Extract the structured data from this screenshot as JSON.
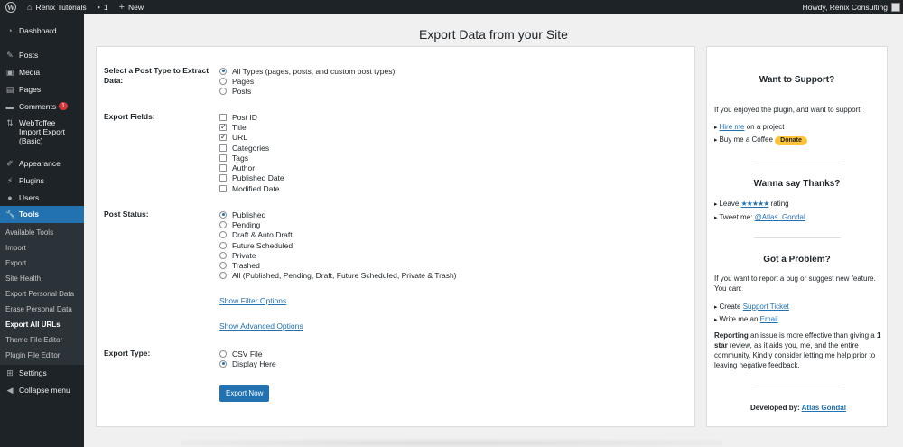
{
  "admin_bar": {
    "site_name": "Renix Tutorials",
    "comments_count": "1",
    "new_label": "New",
    "howdy": "Howdy, Renix Consulting"
  },
  "sidebar": {
    "items": [
      {
        "label": "Dashboard",
        "icon": "dashboard-icon"
      },
      {
        "label": "Posts",
        "icon": "pin-icon"
      },
      {
        "label": "Media",
        "icon": "media-icon"
      },
      {
        "label": "Pages",
        "icon": "pages-icon"
      },
      {
        "label": "Comments",
        "icon": "comment-icon",
        "badge": "1"
      },
      {
        "label": "WebToffee Import Export (Basic)",
        "icon": "import-export-icon"
      },
      {
        "label": "Appearance",
        "icon": "brush-icon"
      },
      {
        "label": "Plugins",
        "icon": "plug-icon"
      },
      {
        "label": "Users",
        "icon": "user-icon"
      },
      {
        "label": "Tools",
        "icon": "wrench-icon"
      }
    ],
    "tools_submenu": [
      "Available Tools",
      "Import",
      "Export",
      "Site Health",
      "Export Personal Data",
      "Erase Personal Data",
      "Export All URLs",
      "Theme File Editor",
      "Plugin File Editor"
    ],
    "settings": "Settings",
    "collapse": "Collapse menu"
  },
  "page_title": "Export Data from your Site",
  "form": {
    "post_type_label": "Select a Post Type to Extract Data:",
    "post_types": [
      "All Types (pages, posts, and custom post types)",
      "Pages",
      "Posts"
    ],
    "post_type_selected": 0,
    "fields_label": "Export Fields:",
    "fields": [
      "Post ID",
      "Title",
      "URL",
      "Categories",
      "Tags",
      "Author",
      "Published Date",
      "Modified Date"
    ],
    "fields_checked": [
      false,
      true,
      true,
      false,
      false,
      false,
      false,
      false
    ],
    "status_label": "Post Status:",
    "statuses": [
      "Published",
      "Pending",
      "Draft & Auto Draft",
      "Future Scheduled",
      "Private",
      "Trashed",
      "All (Published, Pending, Draft, Future Scheduled, Private & Trash)"
    ],
    "status_selected": 0,
    "show_filter": "Show Filter Options",
    "show_advanced": "Show Advanced Options",
    "export_type_label": "Export Type:",
    "export_types": [
      "CSV File",
      "Display Here"
    ],
    "export_type_selected": 1,
    "export_button": "Export Now"
  },
  "side": {
    "support_title": "Want to Support?",
    "support_intro": "If you enjoyed the plugin, and want to support:",
    "hire_link": "Hire me",
    "hire_rest": " on a project",
    "coffee": "Buy me a Coffee",
    "donate": "Donate",
    "thanks_title": "Wanna say Thanks?",
    "leave": "Leave ",
    "stars": "★★★★★",
    "rating": " rating",
    "tweet": "Tweet me: ",
    "tweet_handle": "@Atlas_Gondal",
    "problem_title": "Got a Problem?",
    "problem_intro": "If you want to report a bug or suggest new feature. You can:",
    "create": "Create ",
    "support_ticket": "Support Ticket",
    "write": "Write me an ",
    "email": "Email",
    "reporting_bold": "Reporting",
    "reporting_mid": " an issue is more effective than giving a ",
    "one_star": "1 star",
    "reporting_rest": " review, as it aids you, me, and the entire community. Kindly consider letting me help prior to leaving negative feedback.",
    "developed_by": "Developed by: ",
    "developer": "Atlas Gondal"
  }
}
